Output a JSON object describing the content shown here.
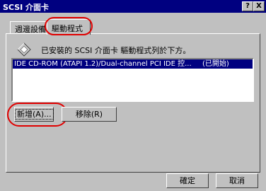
{
  "window": {
    "title": "SCSI 介面卡",
    "help_label": "?",
    "close_label": "X"
  },
  "tabs": [
    {
      "label": "週邊設備",
      "active": false
    },
    {
      "label": "驅動程式",
      "active": true
    }
  ],
  "info": {
    "text": "已安裝的 SCSI 介面卡 驅動程式列於下方。",
    "icon": "diamond-icon"
  },
  "drivers": [
    {
      "name": "IDE CD-ROM (ATAPI 1.2)/Dual-channel PCI IDE 控...",
      "status": "(已開始)"
    }
  ],
  "buttons": {
    "add": "新增(A)...",
    "remove": "移除(R)",
    "ok": "確定",
    "cancel": "取消"
  },
  "colors": {
    "titlebar": "#000080",
    "highlight": "#000080",
    "annotation": "#e00000",
    "face": "#c0c0c0"
  }
}
